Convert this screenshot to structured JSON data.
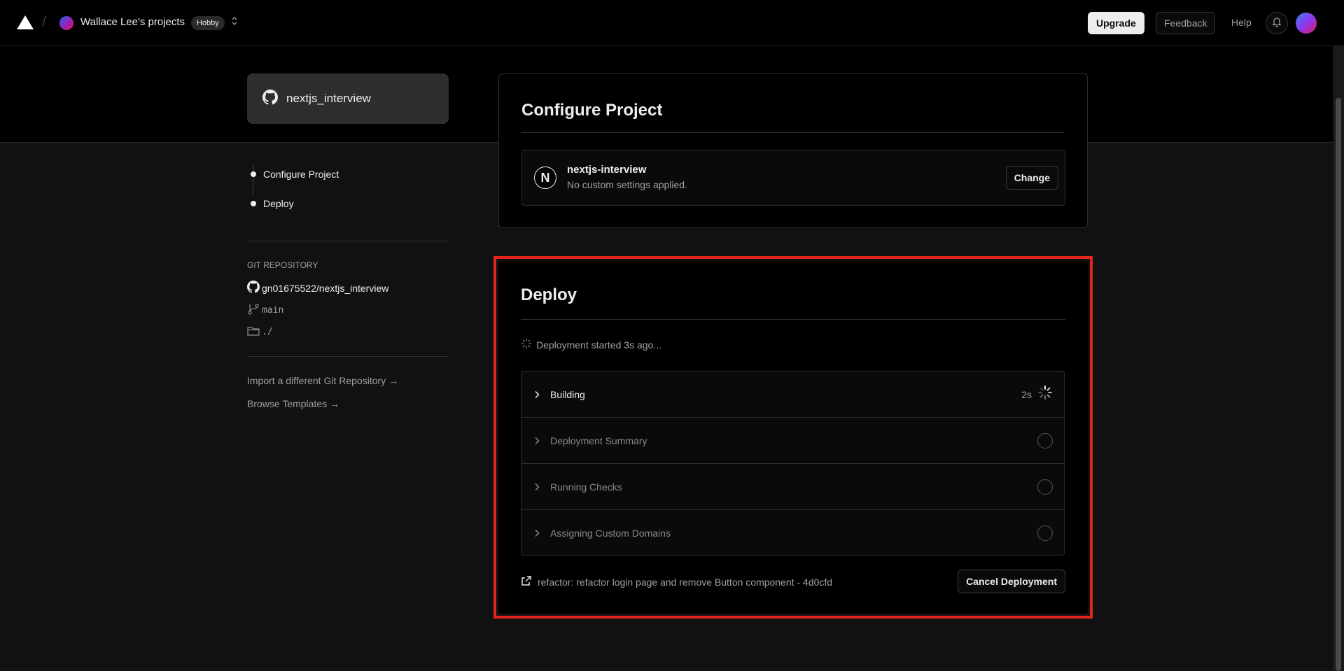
{
  "header": {
    "team_name": "Wallace Lee's projects",
    "plan_badge": "Hobby",
    "upgrade_label": "Upgrade",
    "feedback_label": "Feedback",
    "help_label": "Help"
  },
  "sidebar": {
    "repo_card_name": "nextjs_interview",
    "steps": [
      {
        "label": "Configure Project"
      },
      {
        "label": "Deploy"
      }
    ],
    "git_heading": "GIT REPOSITORY",
    "git_repo": "gn01675522/nextjs_interview",
    "git_branch": "main",
    "git_root": "./",
    "links": [
      {
        "label": "Import a different Git Repository →"
      },
      {
        "label": "Browse Templates →"
      }
    ]
  },
  "configure": {
    "title": "Configure Project",
    "framework_name": "nextjs-interview",
    "framework_sub": "No custom settings applied.",
    "framework_logo_letter": "N",
    "change_label": "Change"
  },
  "deploy": {
    "title": "Deploy",
    "status": "Deployment started 3s ago...",
    "steps": [
      {
        "name": "Building",
        "elapsed": "2s",
        "state": "running"
      },
      {
        "name": "Deployment Summary",
        "elapsed": "",
        "state": "pending"
      },
      {
        "name": "Running Checks",
        "elapsed": "",
        "state": "pending"
      },
      {
        "name": "Assigning Custom Domains",
        "elapsed": "",
        "state": "pending"
      }
    ],
    "commit": "refactor: refactor login page and remove Button component - 4d0cfd",
    "cancel_label": "Cancel Deployment"
  },
  "colors": {
    "highlight_outline": "#e5241c",
    "background": "#111111",
    "panel": "#000000"
  }
}
